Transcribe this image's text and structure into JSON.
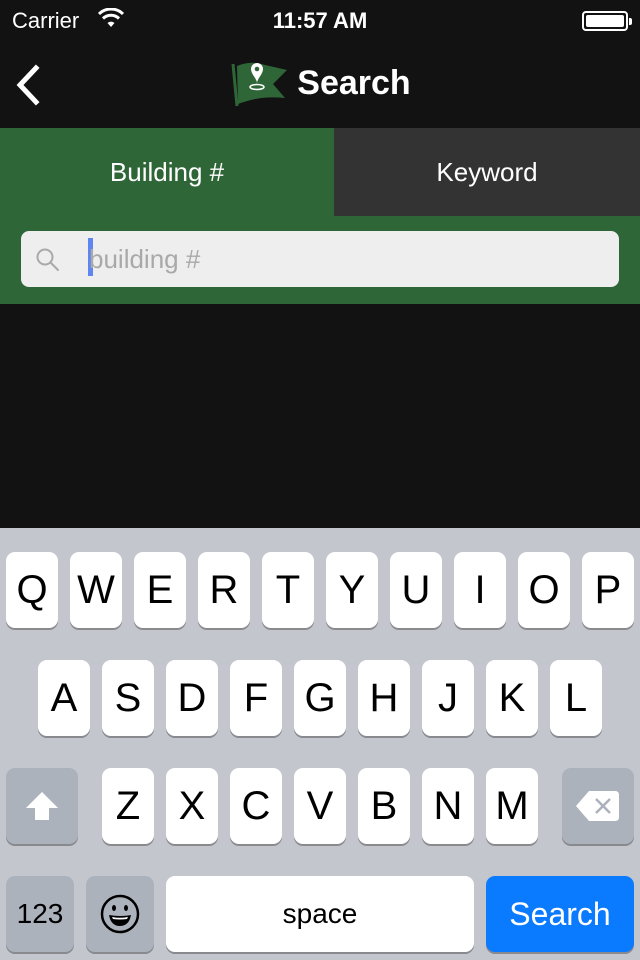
{
  "status_bar": {
    "carrier": "Carrier",
    "time": "11:57 AM",
    "battery_percent": 100
  },
  "nav": {
    "back_icon": "chevron-left-icon",
    "logo_icon": "flag-location-icon",
    "title": "Search"
  },
  "tabs": [
    {
      "label": "Building #",
      "selected": true
    },
    {
      "label": "Keyword",
      "selected": false
    }
  ],
  "search": {
    "value": "",
    "placeholder": "building #",
    "icon": "search-icon"
  },
  "keyboard": {
    "row1": [
      "Q",
      "W",
      "E",
      "R",
      "T",
      "Y",
      "U",
      "I",
      "O",
      "P"
    ],
    "row2": [
      "A",
      "S",
      "D",
      "F",
      "G",
      "H",
      "J",
      "K",
      "L"
    ],
    "row3": [
      "Z",
      "X",
      "C",
      "V",
      "B",
      "N",
      "M"
    ],
    "shift_icon": "shift-icon",
    "delete_icon": "delete-icon",
    "numbers_label": "123",
    "emoji_icon": "emoji-icon",
    "space_label": "space",
    "return_label": "Search"
  },
  "colors": {
    "accent_green": "#2f6638",
    "return_blue": "#0a7bff"
  }
}
